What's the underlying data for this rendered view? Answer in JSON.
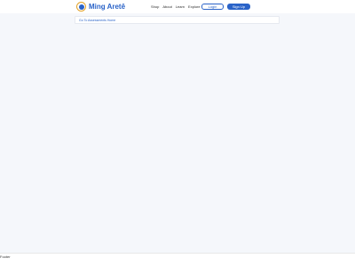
{
  "brand": {
    "name": "Ming Aretê",
    "logo_icon": "ming-logo-icon"
  },
  "nav": {
    "items": [
      {
        "label": "Shop"
      },
      {
        "label": "About"
      },
      {
        "label": "Learn"
      },
      {
        "label": "Explore"
      }
    ],
    "login_label": "Login",
    "signup_label": "Sign Up"
  },
  "main": {
    "link_label": "Go To Assessments Home"
  },
  "footer": {
    "label": "Footer"
  },
  "colors": {
    "brand_blue": "#2a63c8",
    "logo_ring": "#e3a32a",
    "background": "#f5f7fb"
  }
}
